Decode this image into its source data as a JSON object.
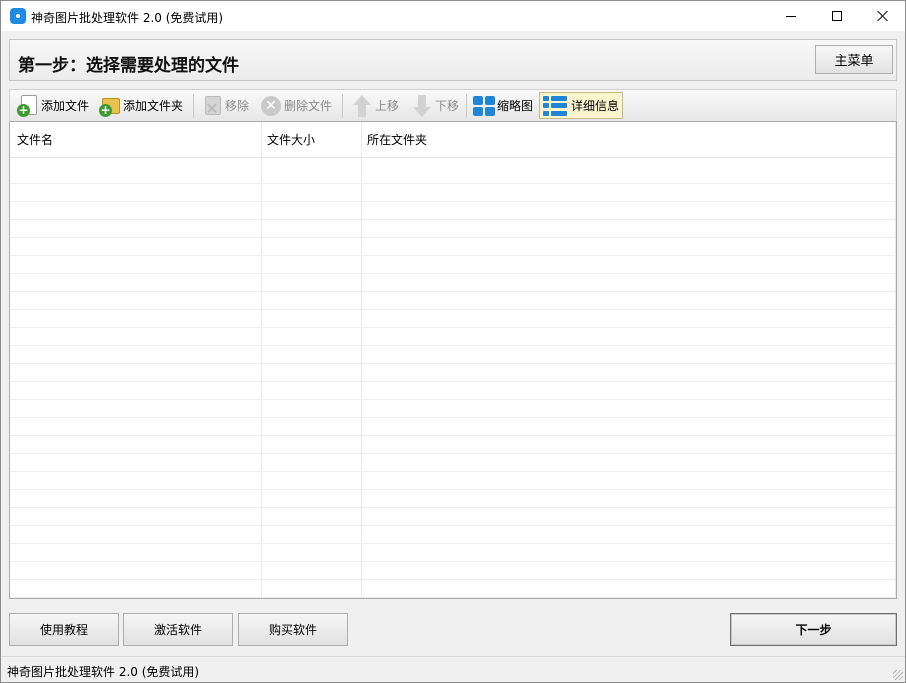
{
  "window": {
    "title": "神奇图片批处理软件 2.0 (免费试用)"
  },
  "header": {
    "step_title": "第一步：选择需要处理的文件",
    "main_menu_label": "主菜单"
  },
  "toolbar": {
    "add_file": "添加文件",
    "add_folder": "添加文件夹",
    "remove": "移除",
    "delete_file": "删除文件",
    "move_up": "上移",
    "move_down": "下移",
    "thumbnail_view": "缩略图",
    "detail_view": "详细信息",
    "active_view": "detail"
  },
  "file_list": {
    "columns": [
      "文件名",
      "文件大小",
      "所在文件夹"
    ],
    "rows": []
  },
  "footer": {
    "tutorial": "使用教程",
    "activate": "激活软件",
    "buy": "购买软件",
    "next": "下一步"
  },
  "statusbar": {
    "text": "神奇图片批处理软件 2.0 (免费试用)"
  },
  "colors": {
    "accent_blue": "#1f86d7",
    "add_green": "#3c9a2e",
    "active_view_bg": "#fcf3cf"
  }
}
